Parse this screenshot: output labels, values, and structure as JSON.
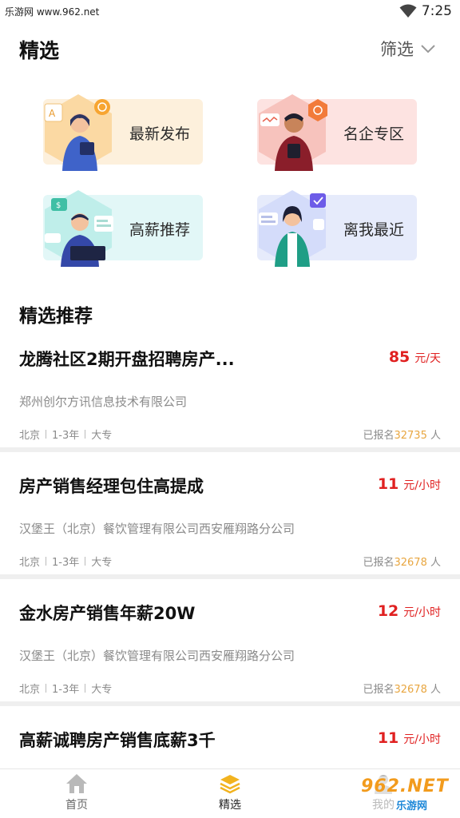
{
  "status_bar": {
    "left_text": "乐游网 www.962.net",
    "time": "7:25"
  },
  "header": {
    "title": "精选",
    "filter_label": "筛选"
  },
  "categories": [
    {
      "label": "最新发布",
      "bg": "#fdf0dc"
    },
    {
      "label": "名企专区",
      "bg": "#fde3e1"
    },
    {
      "label": "高薪推荐",
      "bg": "#e2f7f7"
    },
    {
      "label": "离我最近",
      "bg": "#e6ebfb"
    }
  ],
  "section_title": "精选推荐",
  "jobs": [
    {
      "title": "龙腾社区2期开盘招聘房产...",
      "salary": "85",
      "unit": "元/天",
      "company": "郑州创尔方讯信息技术有限公司",
      "tags": [
        "北京",
        "1-3年",
        "大专"
      ],
      "signup_prefix": "已报名",
      "signup_count": "32735",
      "signup_suffix": "人"
    },
    {
      "title": "房产销售经理包住高提成",
      "salary": "11",
      "unit": "元/小时",
      "company": "汉堡王（北京）餐饮管理有限公司西安雁翔路分公司",
      "tags": [
        "北京",
        "1-3年",
        "大专"
      ],
      "signup_prefix": "已报名",
      "signup_count": "32678",
      "signup_suffix": "人"
    },
    {
      "title": "金水房产销售年薪20W",
      "salary": "12",
      "unit": "元/小时",
      "company": "汉堡王（北京）餐饮管理有限公司西安雁翔路分公司",
      "tags": [
        "北京",
        "1-3年",
        "大专"
      ],
      "signup_prefix": "已报名",
      "signup_count": "32678",
      "signup_suffix": "人"
    },
    {
      "title": "高薪诚聘房产销售底薪3千",
      "salary": "11",
      "unit": "元/小时"
    }
  ],
  "bottom_nav": [
    {
      "label": "首页",
      "icon": "home-icon"
    },
    {
      "label": "精选",
      "icon": "layers-icon",
      "active": true
    },
    {
      "label": "我的",
      "icon": "user-icon"
    }
  ],
  "watermark": {
    "text": "962.NET",
    "sub": "乐游网"
  },
  "colors": {
    "salary": "#e02020",
    "signup_count": "#e8a640",
    "watermark_orange": "#f29b1d",
    "watermark_blue": "#1e88d8"
  }
}
